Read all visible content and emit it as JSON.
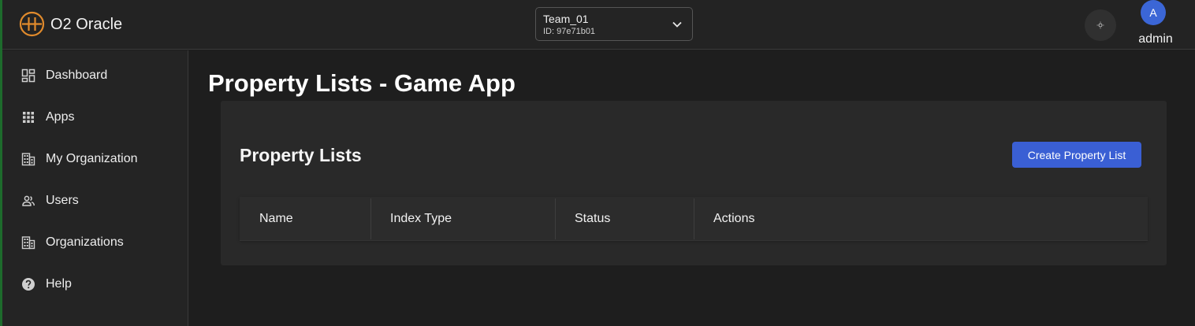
{
  "app": {
    "brand": "O2 Oracle"
  },
  "team_selector": {
    "name": "Team_01",
    "id_text": "ID: 97e71b01"
  },
  "user": {
    "avatar_letter": "A",
    "name": "admin"
  },
  "sidebar": {
    "items": [
      {
        "label": "Dashboard",
        "icon": "dashboard-icon"
      },
      {
        "label": "Apps",
        "icon": "apps-grid-icon"
      },
      {
        "label": "My Organization",
        "icon": "building-icon"
      },
      {
        "label": "Users",
        "icon": "users-icon"
      },
      {
        "label": "Organizations",
        "icon": "building-icon"
      },
      {
        "label": "Help",
        "icon": "help-icon"
      }
    ]
  },
  "main": {
    "page_title": "Property Lists - Game App",
    "card_title": "Property Lists",
    "create_button": "Create Property List",
    "table": {
      "columns": [
        "Name",
        "Index Type",
        "Status",
        "Actions"
      ],
      "rows": []
    }
  },
  "colors": {
    "accent": "#3a5fd4",
    "logo": "#e08a2c",
    "background": "#1e1e1e"
  }
}
